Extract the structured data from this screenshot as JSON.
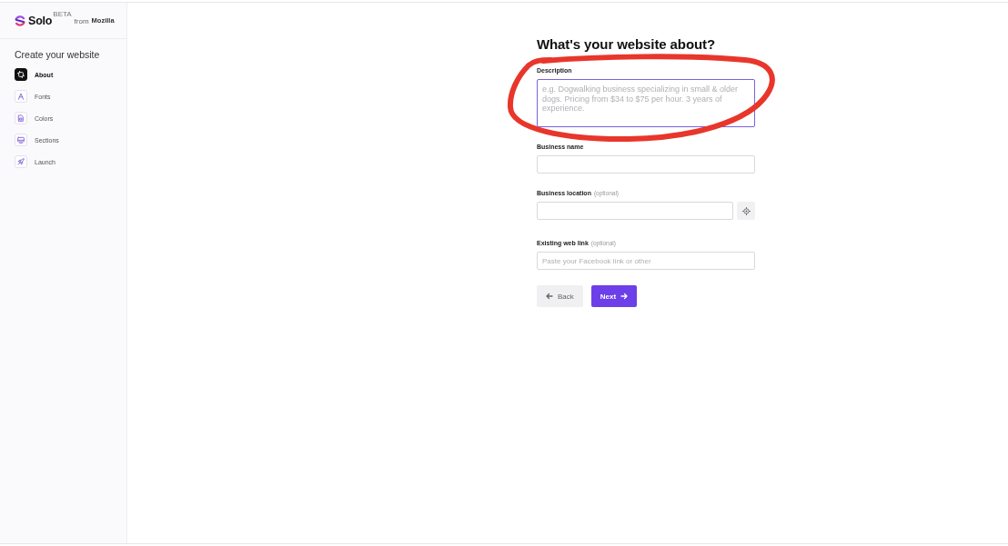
{
  "sidebar": {
    "logo": {
      "name": "Solo",
      "tag": "BETA",
      "byline": "from",
      "brand": "Mozilla"
    },
    "heading": "Create your website",
    "steps": [
      {
        "label": "About",
        "selected": true
      },
      {
        "label": "Fonts",
        "selected": false
      },
      {
        "label": "Colors",
        "selected": false
      },
      {
        "label": "Sections",
        "selected": false
      },
      {
        "label": "Launch",
        "selected": false
      }
    ]
  },
  "form": {
    "title": "What's your website about?",
    "fields": [
      {
        "kind": "textarea",
        "label": "Description",
        "placeholder": "e.g. Dogwalking business specializing in small & older dogs. Pricing from $34 to $75 per hour. 3 years of experience."
      },
      {
        "kind": "text",
        "label": "Business name"
      },
      {
        "kind": "location",
        "label": "Business location",
        "note": "(optional)"
      },
      {
        "kind": "text",
        "label": "Existing web link",
        "note": "(optional)",
        "placeholder": "Paste your Facebook link or other"
      }
    ],
    "buttons": [
      {
        "kind": "back",
        "label": "Back"
      },
      {
        "kind": "primary",
        "label": "Next"
      }
    ]
  }
}
